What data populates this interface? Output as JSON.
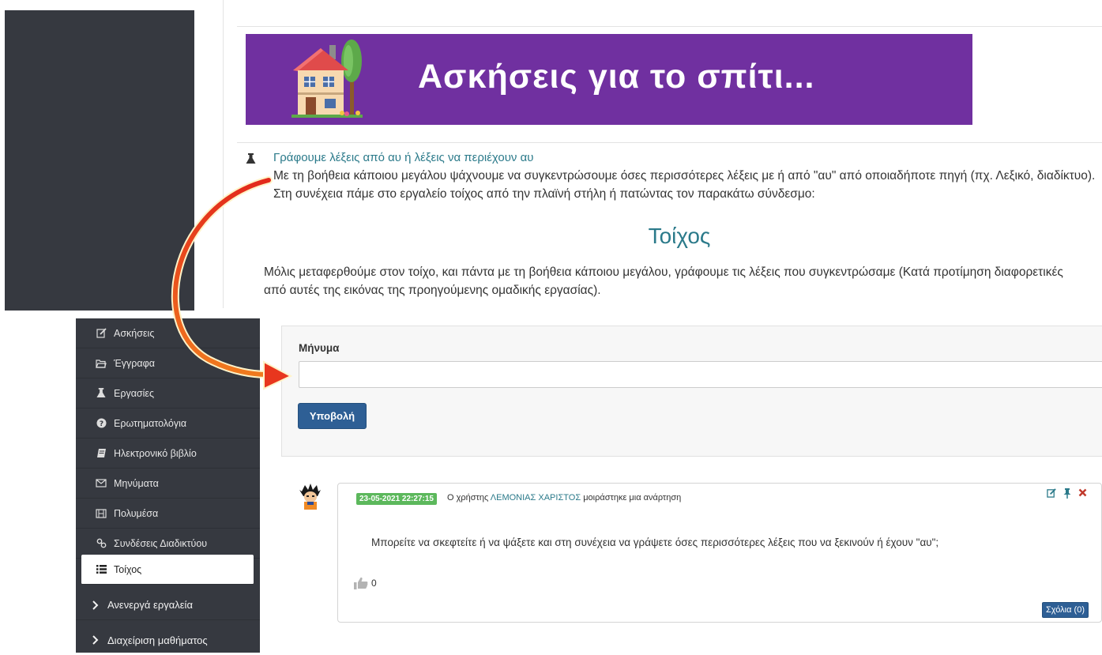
{
  "banner": {
    "title": "Ασκήσεις για το σπίτι..."
  },
  "assignment": {
    "link": "Γράφουμε λέξεις από αυ ή λέξεις να περιέχουν αυ",
    "description": "Με τη βοήθεια κάποιου μεγάλου ψάχνουμε να συγκεντρώσουμε όσες περισσότερες λέξεις με ή από \"αυ\" από οποιαδήποτε πηγή (πχ. Λεξικό, διαδίκτυο). Στη συνέχεια πάμε στο εργαλείο τοίχος από την πλαϊνή στήλη ή πατώντας τον παρακάτω σύνδεσμο:",
    "wall_link": "Τοίχος",
    "after_text": "Μόλις μεταφερθούμε στον τοίχο, και πάντα με τη βοήθεια κάποιου μεγάλου, γράφουμε τις λέξεις που συγκεντρώσαμε (Κατά προτίμηση διαφορετικές από αυτές της εικόνας της προηγούμενης ομαδικής εργασίας)."
  },
  "sidebar": {
    "items": [
      {
        "label": "Ασκήσεις",
        "icon": "edit-icon"
      },
      {
        "label": "Έγγραφα",
        "icon": "folder-icon"
      },
      {
        "label": "Εργασίες",
        "icon": "flask-icon"
      },
      {
        "label": "Ερωτηματολόγια",
        "icon": "question-circle-icon"
      },
      {
        "label": "Ηλεκτρονικό βιβλίο",
        "icon": "book-icon"
      },
      {
        "label": "Μηνύματα",
        "icon": "envelope-icon"
      },
      {
        "label": "Πολυμέσα",
        "icon": "film-icon"
      },
      {
        "label": "Συνδέσεις Διαδικτύου",
        "icon": "link-icon"
      },
      {
        "label": "Τοίχος",
        "icon": "list-icon",
        "active": true
      }
    ],
    "groups": [
      {
        "label": "Ανενεργά εργαλεία",
        "icon": "chevron-right-icon"
      },
      {
        "label": "Διαχείριση μαθήματος",
        "icon": "chevron-right-icon"
      }
    ]
  },
  "message_form": {
    "label": "Μήνυμα",
    "value": "",
    "submit_label": "Υποβολή"
  },
  "post": {
    "date": "23-05-2021 22:27:15",
    "meta_prefix": "Ο χρήστης",
    "user": "ΛΕΜΟΝΙΑΣ ΧΑΡΙΣΤΟΣ",
    "meta_suffix": "μοιράστηκε μια ανάρτηση",
    "body": "Μπορείτε να σκεφτείτε ή να ψάξετε και στη συνέχεια να γράψετε όσες περισσότερες λέξεις που να ξεκινούν ή έχουν \"αυ\";",
    "likes": "0",
    "comments_label": "Σχόλια (0)"
  },
  "colors": {
    "banner_bg": "#7030a0",
    "sidebar_bg": "#363940",
    "link": "#2b7a8a",
    "primary_button": "#2e5f95",
    "date_badge": "#5cb85c",
    "arrow": "#e8361e"
  }
}
